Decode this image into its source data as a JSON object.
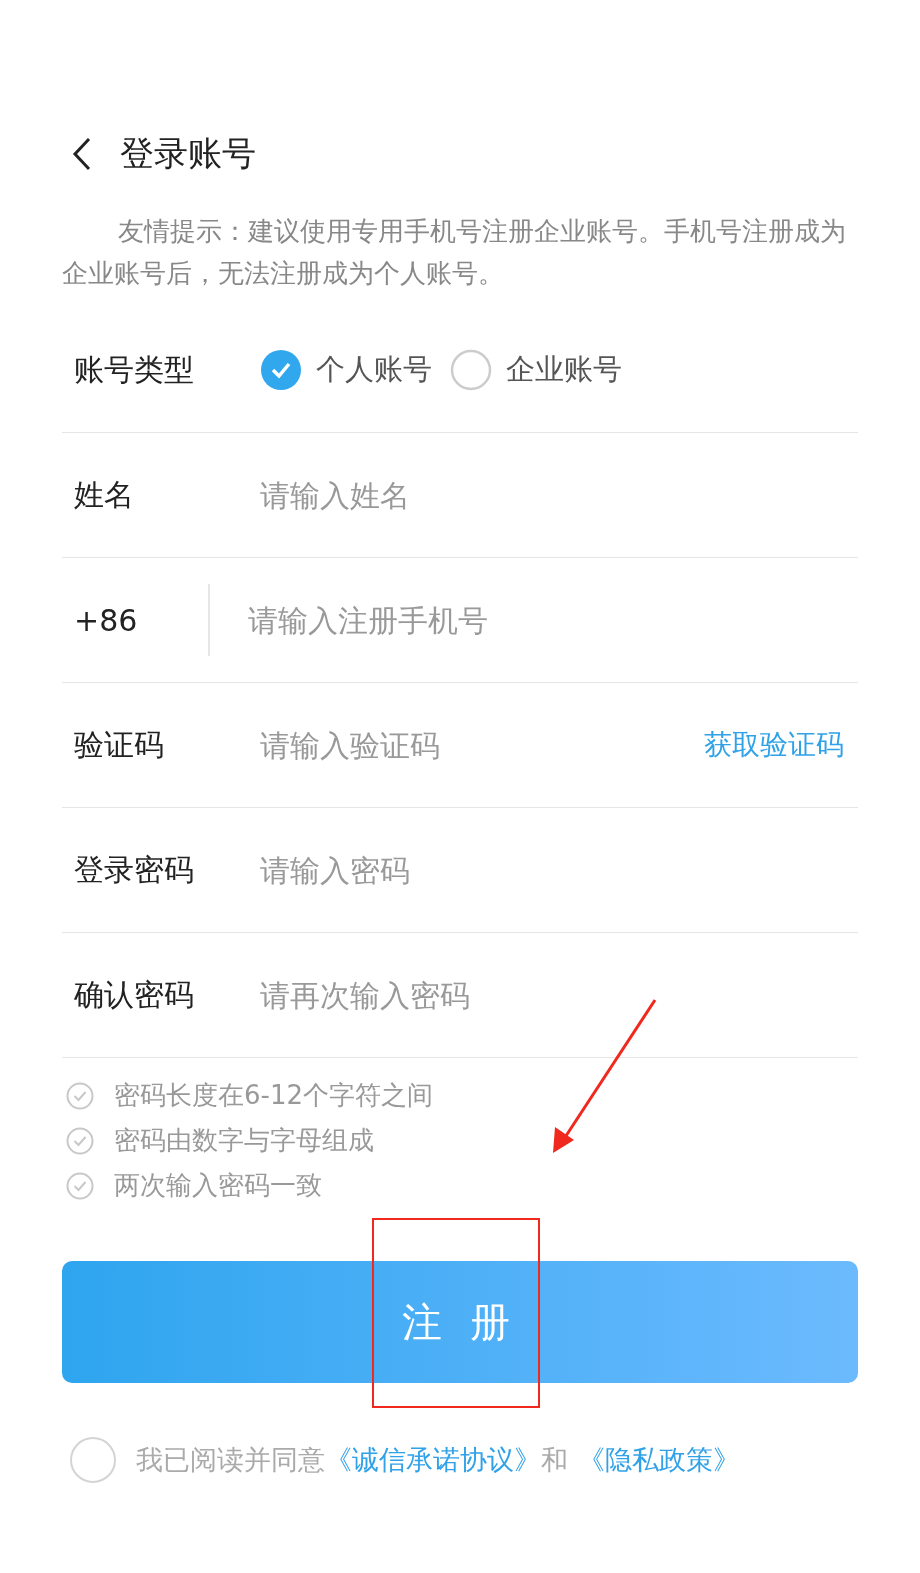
{
  "header": {
    "title": "登录账号"
  },
  "tip": "友情提示：建议使用专用手机号注册企业账号。手机号注册成为企业账号后，无法注册成为个人账号。",
  "rows": [
    {
      "kind": "radio",
      "label": "账号类型",
      "options": [
        {
          "label": "个人账号",
          "selected": true
        },
        {
          "label": "企业账号",
          "selected": false
        }
      ]
    },
    {
      "kind": "input",
      "label": "姓名",
      "placeholder": "请输入姓名"
    },
    {
      "kind": "phone",
      "label": "+86",
      "placeholder": "请输入注册手机号"
    },
    {
      "kind": "code",
      "label": "验证码",
      "placeholder": "请输入验证码",
      "action": "获取验证码"
    },
    {
      "kind": "input",
      "label": "登录密码",
      "placeholder": "请输入密码"
    },
    {
      "kind": "input",
      "label": "确认密码",
      "placeholder": "请再次输入密码"
    }
  ],
  "rules": [
    {
      "text": "密码长度在6-12个字符之间",
      "checked": false
    },
    {
      "text": "密码由数字与字母组成",
      "checked": false
    },
    {
      "text": "两次输入密码一致",
      "checked": false
    }
  ],
  "submit": "注 册",
  "agreement": {
    "checked": false,
    "text": "我已阅读并同意",
    "link1": "《诚信承诺协议》",
    "joiner": "和",
    "link2": "《隐私政策》"
  }
}
